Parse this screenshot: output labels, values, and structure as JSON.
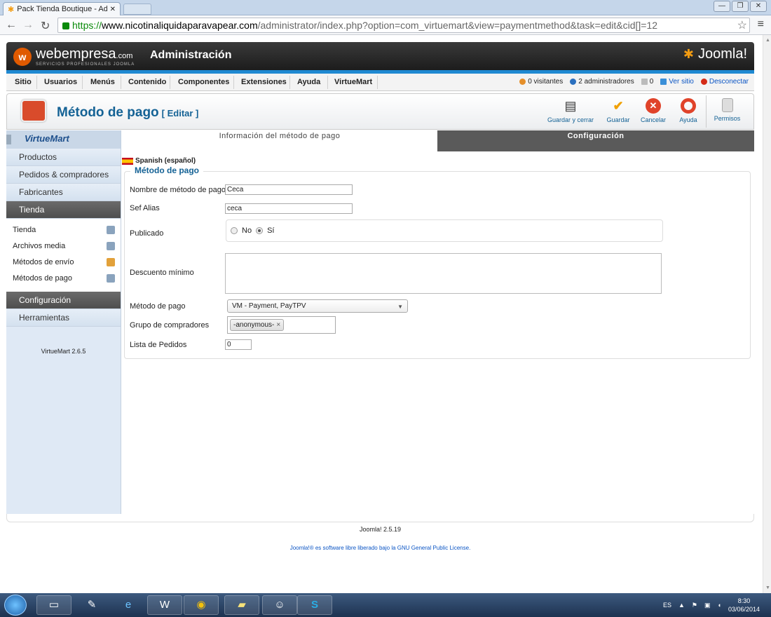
{
  "browser": {
    "tab_title": "Pack Tienda Boutique - Ad",
    "url_https": "https://",
    "url_host": "www.nicotinaliquidaparavapear.com",
    "url_path": "/administrator/index.php?option=com_virtuemart&view=paymentmethod&task=edit&cid[]=12"
  },
  "header": {
    "logo_brand": "webempresa",
    "logo_tld": ".com",
    "logo_sub": "SERVICIOS PROFESIONALES JOOMLA",
    "admin_title": "Administración",
    "joomla_logo": "Joomla!"
  },
  "adminmenu": {
    "items": [
      "Sitio",
      "Usuarios",
      "Menús",
      "Contenido",
      "Componentes",
      "Extensiones",
      "Ayuda",
      "VirtueMart"
    ],
    "visitors": "0 visitantes",
    "admins": "2 administradores",
    "messages": "0",
    "view_site": "Ver sitio",
    "logout": "Desconectar"
  },
  "toolbar": {
    "title": "Método de pago",
    "edit": "[ Editar ]",
    "buttons": {
      "save_close": "Guardar y cerrar",
      "save": "Guardar",
      "cancel": "Cancelar",
      "help": "Ayuda",
      "permissions": "Permisos"
    }
  },
  "sidebar": {
    "logo": "VirtueMart",
    "items": [
      "Productos",
      "Pedidos & compradores",
      "Fabricantes",
      "Tienda"
    ],
    "subitems": [
      "Tienda",
      "Archivos media",
      "Métodos de envío",
      "Métodos de pago"
    ],
    "items2": [
      "Configuración",
      "Herramientas"
    ],
    "version": "VirtueMart 2.6.5"
  },
  "tabs": {
    "info": "Información del método de pago",
    "config": "Configuración"
  },
  "form": {
    "language": "Spanish (español)",
    "legend": "Método de pago",
    "name_label": "Nombre de método de pago",
    "name_value": "Ceca",
    "alias_label": "Sef Alias",
    "alias_value": "ceca",
    "published_label": "Publicado",
    "no": "No",
    "yes": "Sí",
    "published": "yes",
    "discount_label": "Descuento mínimo",
    "method_label": "Método de pago",
    "method_value": "VM - Payment, PayTPV",
    "group_label": "Grupo de compradores",
    "group_chip": "-anonymous-",
    "orders_label": "Lista de Pedidos",
    "orders_value": "0"
  },
  "footer": {
    "version": "Joomla! 2.5.19",
    "license_prefix": "Joomla!® es software libre liberado bajo la",
    "license_link": "GNU General Public License",
    "license_suffix": "."
  },
  "taskbar": {
    "lang": "ES",
    "time": "8:30",
    "date": "03/06/2014"
  }
}
